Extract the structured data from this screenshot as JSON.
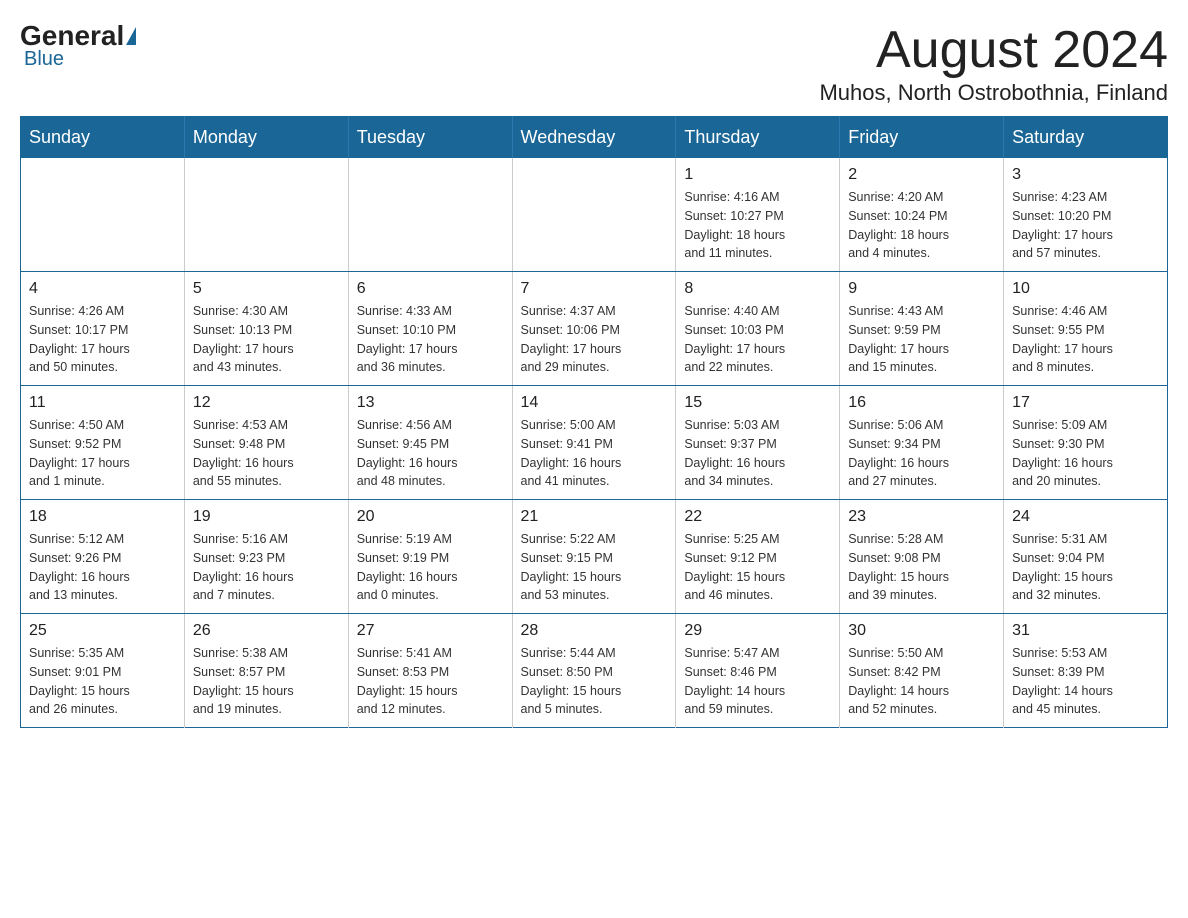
{
  "header": {
    "logo": {
      "general": "General",
      "blue": "Blue"
    },
    "title": "August 2024",
    "location": "Muhos, North Ostrobothnia, Finland"
  },
  "calendar": {
    "weekdays": [
      "Sunday",
      "Monday",
      "Tuesday",
      "Wednesday",
      "Thursday",
      "Friday",
      "Saturday"
    ],
    "weeks": [
      [
        {
          "day": "",
          "info": ""
        },
        {
          "day": "",
          "info": ""
        },
        {
          "day": "",
          "info": ""
        },
        {
          "day": "",
          "info": ""
        },
        {
          "day": "1",
          "info": "Sunrise: 4:16 AM\nSunset: 10:27 PM\nDaylight: 18 hours\nand 11 minutes."
        },
        {
          "day": "2",
          "info": "Sunrise: 4:20 AM\nSunset: 10:24 PM\nDaylight: 18 hours\nand 4 minutes."
        },
        {
          "day": "3",
          "info": "Sunrise: 4:23 AM\nSunset: 10:20 PM\nDaylight: 17 hours\nand 57 minutes."
        }
      ],
      [
        {
          "day": "4",
          "info": "Sunrise: 4:26 AM\nSunset: 10:17 PM\nDaylight: 17 hours\nand 50 minutes."
        },
        {
          "day": "5",
          "info": "Sunrise: 4:30 AM\nSunset: 10:13 PM\nDaylight: 17 hours\nand 43 minutes."
        },
        {
          "day": "6",
          "info": "Sunrise: 4:33 AM\nSunset: 10:10 PM\nDaylight: 17 hours\nand 36 minutes."
        },
        {
          "day": "7",
          "info": "Sunrise: 4:37 AM\nSunset: 10:06 PM\nDaylight: 17 hours\nand 29 minutes."
        },
        {
          "day": "8",
          "info": "Sunrise: 4:40 AM\nSunset: 10:03 PM\nDaylight: 17 hours\nand 22 minutes."
        },
        {
          "day": "9",
          "info": "Sunrise: 4:43 AM\nSunset: 9:59 PM\nDaylight: 17 hours\nand 15 minutes."
        },
        {
          "day": "10",
          "info": "Sunrise: 4:46 AM\nSunset: 9:55 PM\nDaylight: 17 hours\nand 8 minutes."
        }
      ],
      [
        {
          "day": "11",
          "info": "Sunrise: 4:50 AM\nSunset: 9:52 PM\nDaylight: 17 hours\nand 1 minute."
        },
        {
          "day": "12",
          "info": "Sunrise: 4:53 AM\nSunset: 9:48 PM\nDaylight: 16 hours\nand 55 minutes."
        },
        {
          "day": "13",
          "info": "Sunrise: 4:56 AM\nSunset: 9:45 PM\nDaylight: 16 hours\nand 48 minutes."
        },
        {
          "day": "14",
          "info": "Sunrise: 5:00 AM\nSunset: 9:41 PM\nDaylight: 16 hours\nand 41 minutes."
        },
        {
          "day": "15",
          "info": "Sunrise: 5:03 AM\nSunset: 9:37 PM\nDaylight: 16 hours\nand 34 minutes."
        },
        {
          "day": "16",
          "info": "Sunrise: 5:06 AM\nSunset: 9:34 PM\nDaylight: 16 hours\nand 27 minutes."
        },
        {
          "day": "17",
          "info": "Sunrise: 5:09 AM\nSunset: 9:30 PM\nDaylight: 16 hours\nand 20 minutes."
        }
      ],
      [
        {
          "day": "18",
          "info": "Sunrise: 5:12 AM\nSunset: 9:26 PM\nDaylight: 16 hours\nand 13 minutes."
        },
        {
          "day": "19",
          "info": "Sunrise: 5:16 AM\nSunset: 9:23 PM\nDaylight: 16 hours\nand 7 minutes."
        },
        {
          "day": "20",
          "info": "Sunrise: 5:19 AM\nSunset: 9:19 PM\nDaylight: 16 hours\nand 0 minutes."
        },
        {
          "day": "21",
          "info": "Sunrise: 5:22 AM\nSunset: 9:15 PM\nDaylight: 15 hours\nand 53 minutes."
        },
        {
          "day": "22",
          "info": "Sunrise: 5:25 AM\nSunset: 9:12 PM\nDaylight: 15 hours\nand 46 minutes."
        },
        {
          "day": "23",
          "info": "Sunrise: 5:28 AM\nSunset: 9:08 PM\nDaylight: 15 hours\nand 39 minutes."
        },
        {
          "day": "24",
          "info": "Sunrise: 5:31 AM\nSunset: 9:04 PM\nDaylight: 15 hours\nand 32 minutes."
        }
      ],
      [
        {
          "day": "25",
          "info": "Sunrise: 5:35 AM\nSunset: 9:01 PM\nDaylight: 15 hours\nand 26 minutes."
        },
        {
          "day": "26",
          "info": "Sunrise: 5:38 AM\nSunset: 8:57 PM\nDaylight: 15 hours\nand 19 minutes."
        },
        {
          "day": "27",
          "info": "Sunrise: 5:41 AM\nSunset: 8:53 PM\nDaylight: 15 hours\nand 12 minutes."
        },
        {
          "day": "28",
          "info": "Sunrise: 5:44 AM\nSunset: 8:50 PM\nDaylight: 15 hours\nand 5 minutes."
        },
        {
          "day": "29",
          "info": "Sunrise: 5:47 AM\nSunset: 8:46 PM\nDaylight: 14 hours\nand 59 minutes."
        },
        {
          "day": "30",
          "info": "Sunrise: 5:50 AM\nSunset: 8:42 PM\nDaylight: 14 hours\nand 52 minutes."
        },
        {
          "day": "31",
          "info": "Sunrise: 5:53 AM\nSunset: 8:39 PM\nDaylight: 14 hours\nand 45 minutes."
        }
      ]
    ]
  }
}
